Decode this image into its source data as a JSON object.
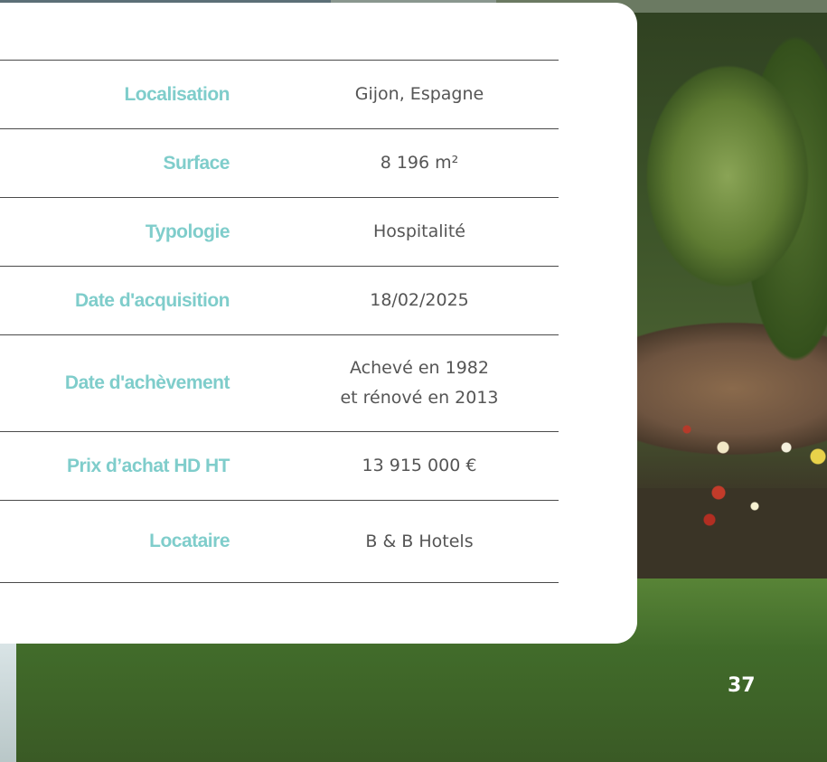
{
  "property": {
    "rows": [
      {
        "label": "Localisation",
        "value": "Gijon, Espagne"
      },
      {
        "label": "Surface",
        "value": "8 196 m²"
      },
      {
        "label": "Typologie",
        "value": "Hospitalité"
      },
      {
        "label": "Date d'acquisition",
        "value": "18/02/2025"
      },
      {
        "label": "Date d'achèvement",
        "value_line1": "Achevé en 1982",
        "value_line2": "et rénové en 2013"
      },
      {
        "label": "Prix d’achat HD HT",
        "value": "13 915 000 €"
      },
      {
        "label": "Locataire",
        "value": "B & B Hotels"
      }
    ]
  },
  "page_number": "37",
  "colors": {
    "label_teal": "#7fcdcb",
    "value_gray": "#555555",
    "card_bg": "#ffffff"
  }
}
